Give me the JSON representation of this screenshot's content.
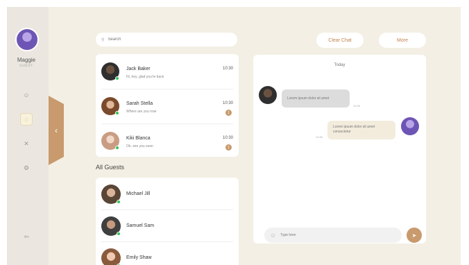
{
  "profile": {
    "name": "Maggie",
    "role": "GUEST"
  },
  "nav": [
    {
      "icon": "people-icon",
      "glyph": "☺",
      "active": false
    },
    {
      "icon": "chat-bubble-icon",
      "glyph": "◌",
      "active": true
    },
    {
      "icon": "tools-icon",
      "glyph": "✕",
      "active": false
    },
    {
      "icon": "settings-icon",
      "glyph": "⚙",
      "active": false
    }
  ],
  "logout_glyph": "⇦",
  "collapse_glyph": "‹",
  "search": {
    "placeholder": "Search",
    "icon_glyph": "⚲"
  },
  "toolbar": {
    "clear_label": "Clear Chat",
    "more_label": "More"
  },
  "recent_chats": [
    {
      "name": "Jack Baker",
      "message": "Hi, hey, glad you're back",
      "time": "10:30",
      "unread": ""
    },
    {
      "name": "Sarah Stella",
      "message": "Where are you now",
      "time": "10:30",
      "unread": "1"
    },
    {
      "name": "Kiki Blanca",
      "message": "Ok, see you soon",
      "time": "10:30",
      "unread": "1"
    }
  ],
  "guests_title": "All Guests",
  "guests": [
    {
      "name": "Michael Jill"
    },
    {
      "name": "Samuel Sam"
    },
    {
      "name": "Emily Shaw"
    }
  ],
  "conversation": {
    "day": "Today",
    "incoming": {
      "text": "Lorem ipsum dolor sit amet",
      "time": "10:30"
    },
    "outgoing": {
      "text": "Lorem ipsum dolor sit amet consectetur",
      "time": "10:30"
    }
  },
  "composer": {
    "placeholder": "Type here",
    "emoji_glyph": "☺",
    "send_glyph": "➤"
  },
  "colors": {
    "accent": "#c89a6d",
    "background": "#f3efe4",
    "online": "#38c255"
  }
}
